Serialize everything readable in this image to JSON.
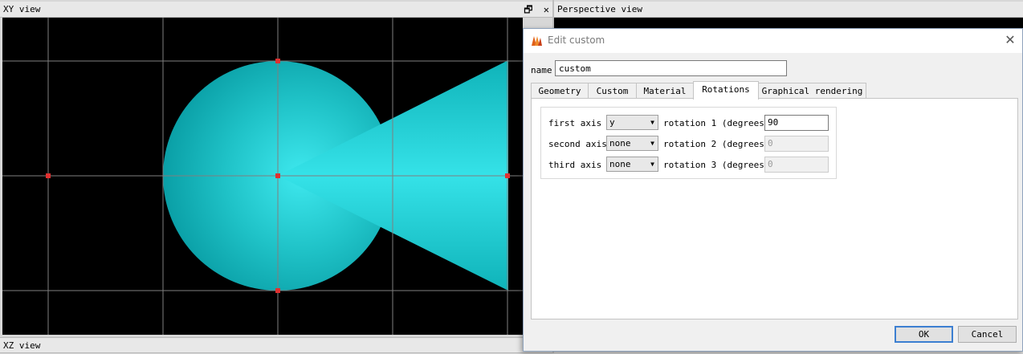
{
  "panels": {
    "xy_title": "XY view",
    "perspective_title": "Perspective view",
    "xz_title": "XZ view",
    "restore_icon": "restore-icon",
    "close_icon": "close-icon"
  },
  "viewport": {
    "background": "#000000",
    "grid_color": "#7f7f7f",
    "shape_color": "#1fc8cc",
    "marker_color": "#e03030"
  },
  "dialog": {
    "title": "Edit custom",
    "name_label": "name",
    "name_value": "custom",
    "tabs": [
      {
        "label": "Geometry"
      },
      {
        "label": "Custom"
      },
      {
        "label": "Material"
      },
      {
        "label": "Rotations"
      },
      {
        "label": "Graphical rendering"
      }
    ],
    "active_tab": "Rotations",
    "rotations": [
      {
        "axis_label": "first axis",
        "axis_value": "y",
        "rot_label": "rotation 1 (degrees)",
        "rot_value": "90"
      },
      {
        "axis_label": "second axis",
        "axis_value": "none",
        "rot_label": "rotation 2 (degrees)",
        "rot_value": "0"
      },
      {
        "axis_label": "third axis",
        "axis_value": "none",
        "rot_label": "rotation 3 (degrees)",
        "rot_value": "0"
      }
    ],
    "ok_label": "OK",
    "cancel_label": "Cancel"
  }
}
